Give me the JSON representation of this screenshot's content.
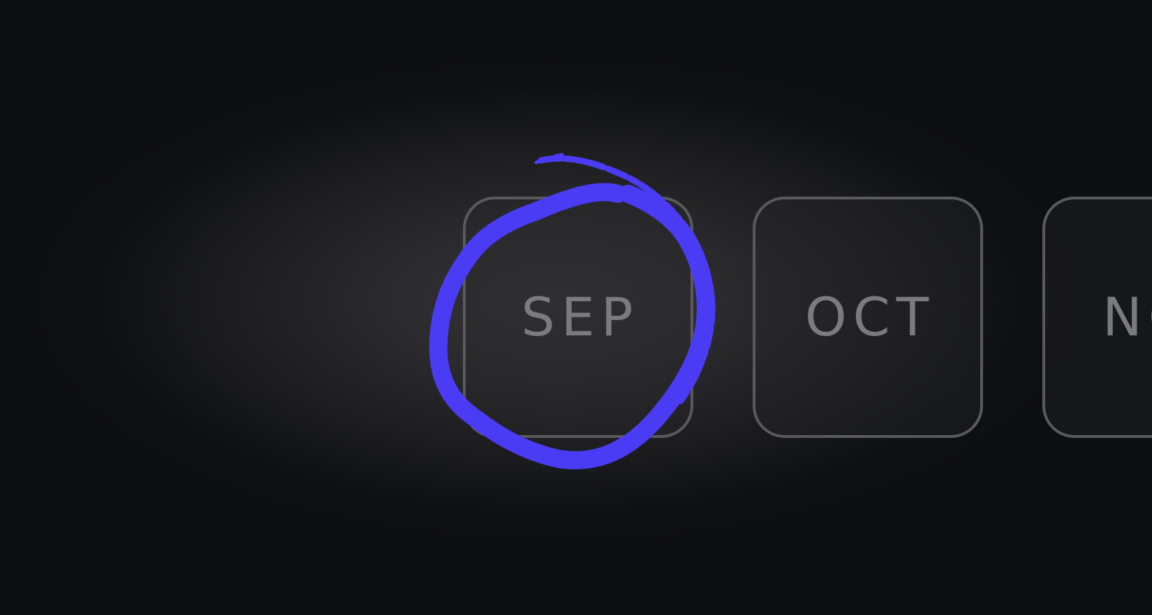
{
  "months": [
    {
      "label": "SEP",
      "selected": true
    },
    {
      "label": "OCT",
      "selected": false
    },
    {
      "label": "NO",
      "selected": false
    }
  ],
  "colors": {
    "highlight": "#4a3cf4",
    "card_border": "#5a5a5d",
    "label": "#7b7b7e"
  },
  "icons": {
    "selection_marker": "hand-drawn-circle"
  }
}
